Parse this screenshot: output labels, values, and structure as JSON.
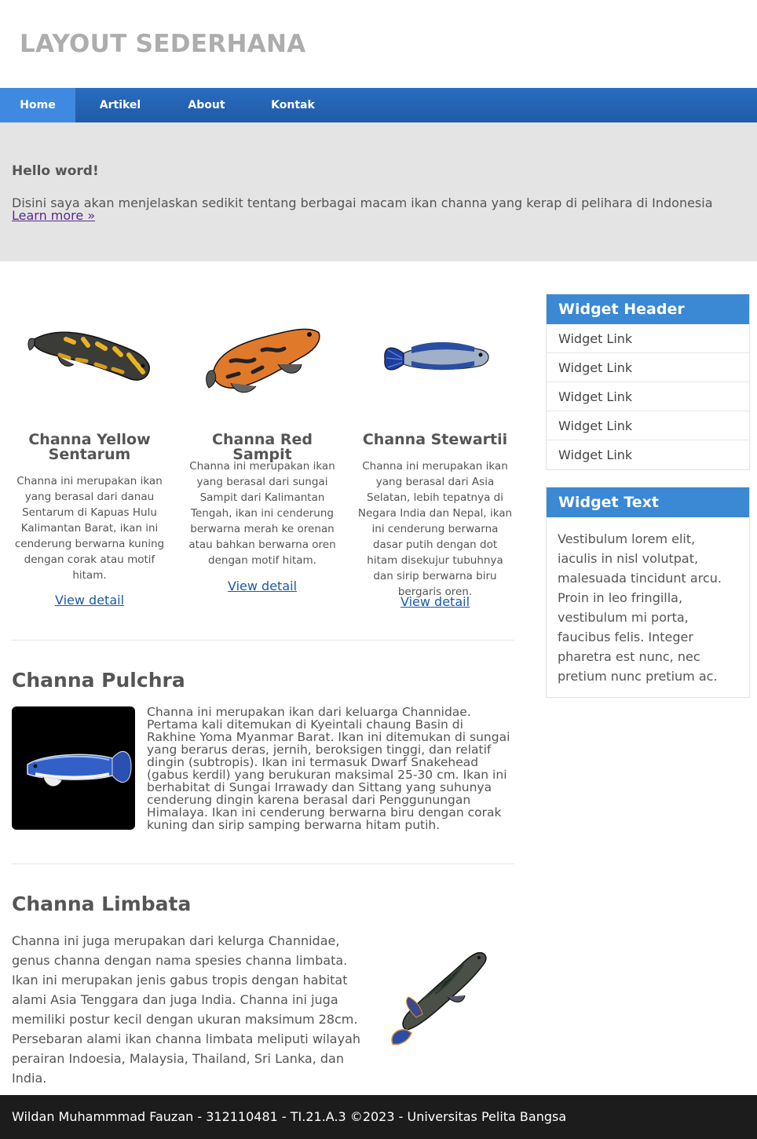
{
  "header": {
    "title": "LAYOUT SEDERHANA"
  },
  "nav": {
    "items": [
      "Home",
      "Artikel",
      "About",
      "Kontak"
    ]
  },
  "hero": {
    "title": "Hello word!",
    "text": "Disini saya akan menjelaskan sedikit tentang berbagai macam ikan channa yang kerap di pelihara di Indonesia",
    "link": "Learn more »"
  },
  "cards": [
    {
      "title": "Channa Yellow Sentarum",
      "text": "Channa ini merupakan ikan yang berasal dari danau Sentarum di Kapuas Hulu Kalimantan Barat, ikan ini cenderung berwarna kuning dengan corak atau motif hitam.",
      "link": "View detail"
    },
    {
      "title": "Channa Red Sampit",
      "text": "Channa ini merupakan ikan yang berasal dari sungai Sampit dari Kalimantan Tengah, ikan ini cenderung berwarna merah ke orenan atau bahkan berwarna oren dengan motif hitam.",
      "link": "View detail"
    },
    {
      "title": "Channa Stewartii",
      "text": "Channa ini merupakan ikan yang berasal dari Asia Selatan, lebih tepatnya di Negara India dan Nepal, ikan ini cenderung berwarna dasar putih dengan dot hitam disekujur tubuhnya dan sirip berwarna biru bergaris oren.",
      "link": "View detail"
    }
  ],
  "pulchra": {
    "title": "Channa Pulchra",
    "text": "Channa ini merupakan ikan dari keluarga Channidae. Pertama kali ditemukan di Kyeintali chaung Basin di Rakhine Yoma Myanmar Barat. Ikan ini ditemukan di sungai yang berarus deras, jernih, beroksigen tinggi, dan relatif dingin (subtropis). Ikan ini termasuk Dwarf Snakehead (gabus kerdil) yang berukuran maksimal 25-30 cm. Ikan ini berhabitat di Sungai Irrawady dan Sittang yang suhunya cenderung dingin karena berasal dari Penggunungan Himalaya. Ikan ini cenderung berwarna biru dengan corak kuning dan sirip samping berwarna hitam putih."
  },
  "limbata": {
    "title": "Channa Limbata",
    "text": "Channa ini juga merupakan dari kelurga Channidae, genus channa dengan nama spesies channa limbata. Ikan ini merupakan jenis gabus tropis dengan habitat alami Asia Tenggara dan juga India. Channa ini juga memiliki postur kecil dengan ukuran maksimum 28cm. Persebaran alami ikan channa limbata meliputi wilayah perairan Indoesia, Malaysia, Thailand, Sri Lanka, dan India."
  },
  "sidebar": {
    "widget1": {
      "header": "Widget Header",
      "links": [
        "Widget Link",
        "Widget Link",
        "Widget Link",
        "Widget Link",
        "Widget Link"
      ]
    },
    "widget2": {
      "header": "Widget Text",
      "text": "Vestibulum lorem elit, iaculis in nisl volutpat, malesuada tincidunt arcu. Proin in leo fringilla, vestibulum mi porta, faucibus felis. Integer pharetra est nunc, nec pretium nunc pretium ac."
    }
  },
  "footer": {
    "text": "Wildan Muhammmad Fauzan - 312110481 - TI.21.A.3 ©2023 - Universitas Pelita Bangsa"
  },
  "colors": {
    "nav": "#1f5ba8",
    "nav_active": "#3f8ae0",
    "widget_header": "#3b88d4",
    "footer": "#1c1c1c",
    "hero": "#e4e4e4"
  }
}
